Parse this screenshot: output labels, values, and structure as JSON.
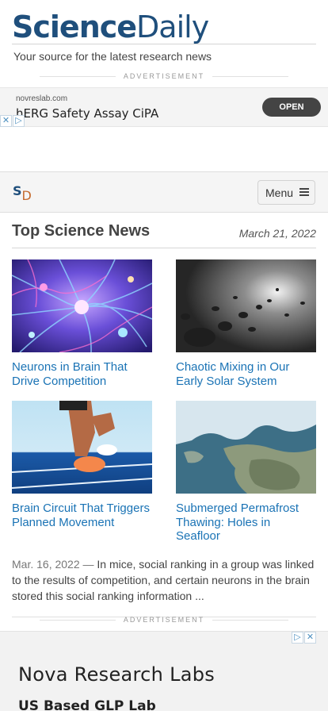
{
  "header": {
    "logo_science": "Science",
    "logo_daily": "Daily",
    "tagline": "Your source for the latest research news",
    "ad_label": "ADVERTISEMENT"
  },
  "ad_top": {
    "domain": "novreslab.com",
    "title": "hERG Safety Assay CiPA",
    "cta": "OPEN"
  },
  "navbar": {
    "logo_s": "S",
    "logo_d": "D",
    "menu_label": "Menu"
  },
  "top_news": {
    "title": "Top Science News",
    "date": "March 21, 2022",
    "stories": [
      {
        "title": "Neurons in Brain That Drive Competition"
      },
      {
        "title": "Chaotic Mixing in Our Early Solar System"
      },
      {
        "title": "Brain Circuit That Triggers Planned Movement"
      },
      {
        "title": "Submerged Permafrost Thawing: Holes in Seafloor"
      }
    ],
    "summary_date": "Mar. 16, 2022",
    "summary_sep": " — ",
    "summary_text": "In mice, social ranking in a group was linked to the results of competition, and certain neurons in the brain stored this social ranking information ..."
  },
  "ad_bottom": {
    "label": "ADVERTISEMENT",
    "title": "Nova Research Labs",
    "subtitle": "US Based GLP Lab"
  },
  "colors": {
    "brand_blue": "#1f4f7c",
    "brand_orange": "#c56a2d",
    "link_blue": "#1a73b5"
  }
}
